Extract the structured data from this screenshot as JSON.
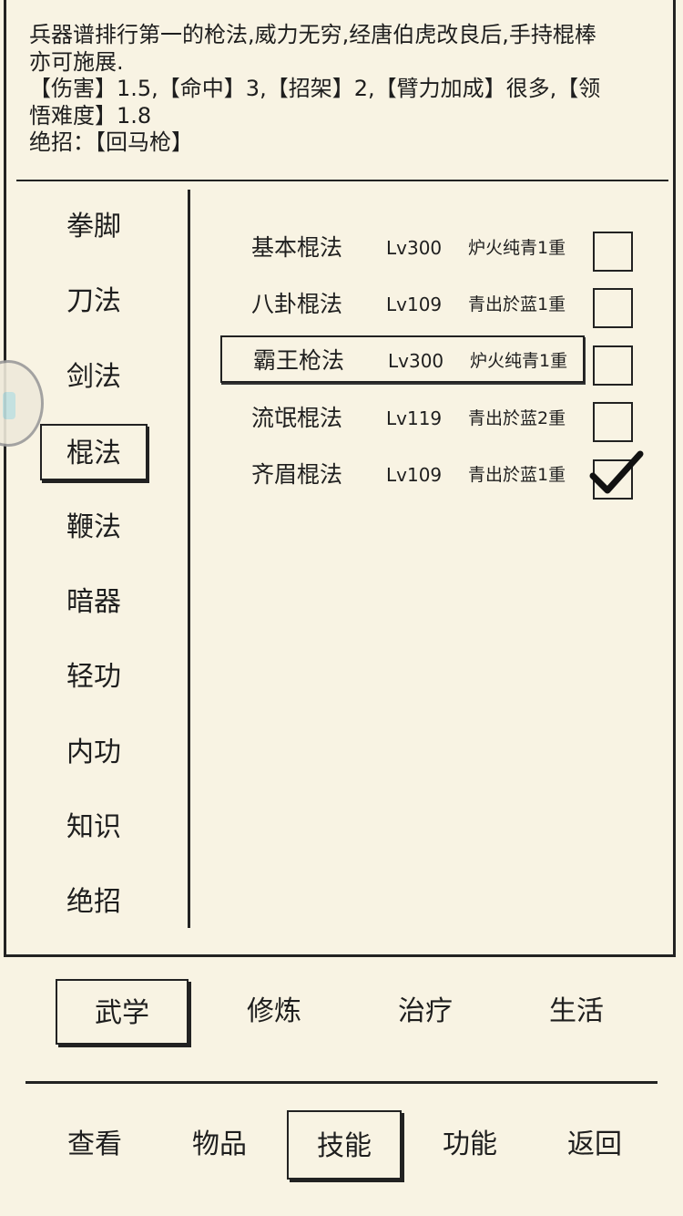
{
  "description": {
    "line1": "兵器谱排行第一的枪法,威力无穷,经唐伯虎改良后,手持棍棒",
    "line2": "亦可施展.",
    "line3": "【伤害】1.5,【命中】3,【招架】2,【臂力加成】很多,【领",
    "line4": "悟难度】1.8",
    "line5": "绝招：【回马枪】"
  },
  "categories": [
    {
      "label": "拳脚"
    },
    {
      "label": "刀法"
    },
    {
      "label": "剑法"
    },
    {
      "label": "棍法",
      "selected": true
    },
    {
      "label": "鞭法"
    },
    {
      "label": "暗器"
    },
    {
      "label": "轻功"
    },
    {
      "label": "内功"
    },
    {
      "label": "知识"
    },
    {
      "label": "绝招"
    }
  ],
  "skills": [
    {
      "name": "基本棍法",
      "level": "Lv300",
      "tier": "炉火纯青1重",
      "checked": false
    },
    {
      "name": "八卦棍法",
      "level": "Lv109",
      "tier": "青出於蓝1重",
      "checked": false
    },
    {
      "name": "霸王枪法",
      "level": "Lv300",
      "tier": "炉火纯青1重",
      "checked": false,
      "selected": true
    },
    {
      "name": "流氓棍法",
      "level": "Lv119",
      "tier": "青出於蓝2重",
      "checked": false
    },
    {
      "name": "齐眉棍法",
      "level": "Lv109",
      "tier": "青出於蓝1重",
      "checked": true
    }
  ],
  "tabs": [
    {
      "label": "武学",
      "selected": true
    },
    {
      "label": "修炼"
    },
    {
      "label": "治疗"
    },
    {
      "label": "生活"
    }
  ],
  "nav": [
    {
      "label": "查看"
    },
    {
      "label": "物品"
    },
    {
      "label": "技能",
      "selected": true
    },
    {
      "label": "功能"
    },
    {
      "label": "返回"
    }
  ]
}
